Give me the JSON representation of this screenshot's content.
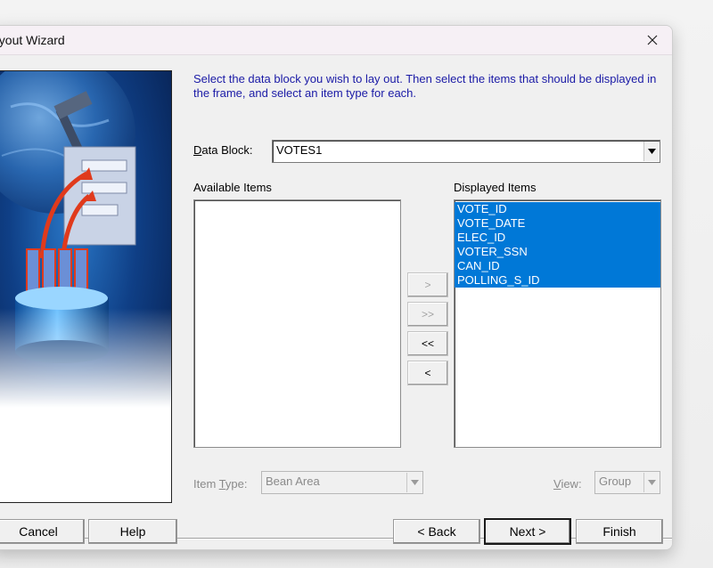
{
  "window": {
    "title": "ayout Wizard"
  },
  "instructions": "Select the data block you wish to lay out. Then select the items that should be displayed in the frame, and select an item type for each.",
  "data_block": {
    "label_accel": "D",
    "label_rest": "ata Block:",
    "value": "VOTES1"
  },
  "available_items": {
    "label": "Available Items",
    "items": []
  },
  "displayed_items": {
    "label": "Displayed Items",
    "items": [
      "VOTE_ID",
      "VOTE_DATE",
      "ELEC_ID",
      "VOTER_SSN",
      "CAN_ID",
      "POLLING_S_ID"
    ]
  },
  "move_buttons": {
    "add": ">",
    "add_all": ">>",
    "remove_all": "<<",
    "remove": "<"
  },
  "item_type": {
    "label_pre": "Item ",
    "label_accel": "T",
    "label_rest": "ype:",
    "value": "Bean Area"
  },
  "view": {
    "label_accel": "V",
    "label_rest": "iew:",
    "value": "Group"
  },
  "buttons": {
    "cancel": "Cancel",
    "help": "Help",
    "back": "< Back",
    "next": "Next >",
    "finish": "Finish"
  },
  "colors": {
    "selection": "#0078d7",
    "instruction_text": "#1a1aa6",
    "title_bar": "#f6f0f5"
  }
}
